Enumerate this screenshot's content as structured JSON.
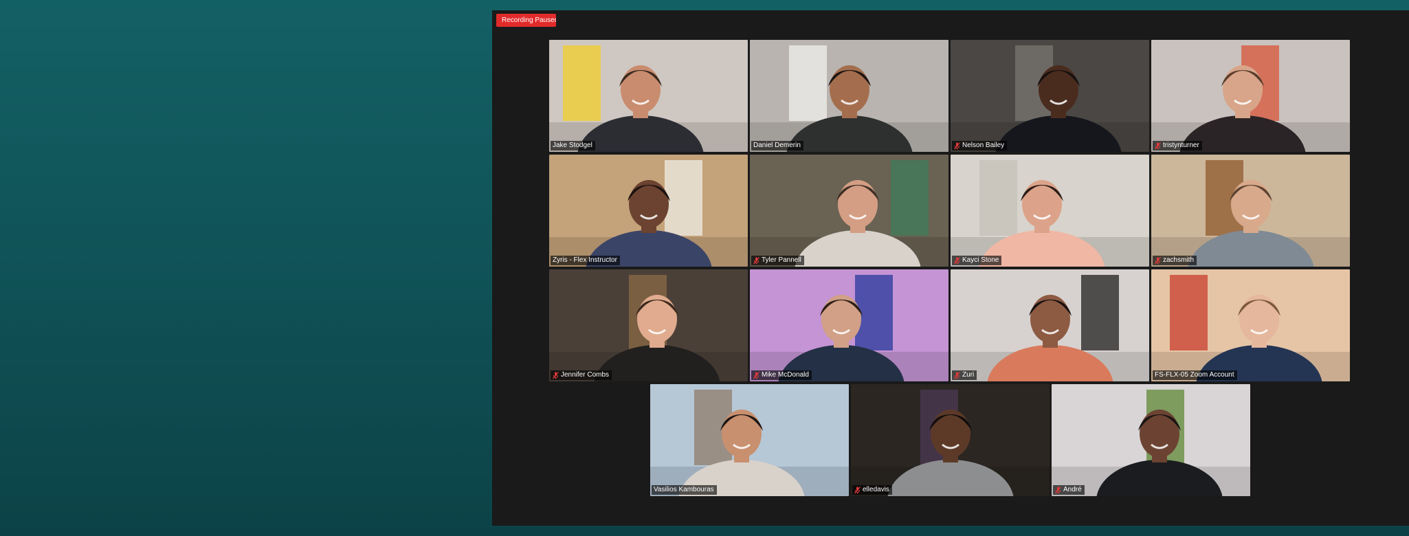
{
  "window": {
    "recording_status": "Recording Paused"
  },
  "participants": [
    {
      "name": "Jake Stodgel",
      "muted": false,
      "active": false,
      "wall": "#cfc7c1",
      "shirt": "#2c2d33",
      "skin": "#c98c6e",
      "hair": "#3a2a20",
      "accent": "#f2cf2a"
    },
    {
      "name": "Daniel Demerin",
      "muted": false,
      "active": true,
      "wall": "#b9b4b0",
      "shirt": "#2e302f",
      "skin": "#a46e4e",
      "hair": "#1c1412",
      "accent": "#f2f0ec"
    },
    {
      "name": "Nelson Bailey",
      "muted": true,
      "active": false,
      "wall": "#4a4744",
      "shirt": "#15171d",
      "skin": "#4a2c1f",
      "hair": "#161010",
      "accent": "#7a7570"
    },
    {
      "name": "tristynturner",
      "muted": true,
      "active": false,
      "wall": "#c9c2be",
      "shirt": "#2a2426",
      "skin": "#d8a58a",
      "hair": "#5b3d2c",
      "accent": "#d8553a"
    },
    {
      "name": "Zyris - Flex Instructor",
      "muted": false,
      "active": false,
      "wall": "#c4a27a",
      "shirt": "#3a4467",
      "skin": "#6b4330",
      "hair": "#1c1210",
      "accent": "#efece6"
    },
    {
      "name": "Tyler Pannell",
      "muted": true,
      "active": false,
      "wall": "#6a6253",
      "shirt": "#d8d2cb",
      "skin": "#d49e84",
      "hair": "#3f2f25",
      "accent": "#3f7c59"
    },
    {
      "name": "Kayci Stone",
      "muted": true,
      "active": false,
      "wall": "#d8d3cc",
      "shirt": "#efb7a4",
      "skin": "#dca38a",
      "hair": "#2b1d18",
      "accent": "#c6c1ba"
    },
    {
      "name": "zachsmith",
      "muted": true,
      "active": false,
      "wall": "#cdb79b",
      "shirt": "#7f8a94",
      "skin": "#d9a98c",
      "hair": "#5d4230",
      "accent": "#8f5a2c"
    },
    {
      "name": "Jennifer Combs",
      "muted": true,
      "active": false,
      "wall": "#4b4038",
      "shirt": "#22201f",
      "skin": "#e0ab8e",
      "hair": "#3e2a1f",
      "accent": "#8a6a46"
    },
    {
      "name": "Mike McDonald",
      "muted": true,
      "active": false,
      "wall": "#c494d4",
      "shirt": "#233045",
      "skin": "#d1a086",
      "hair": "#2d1e17",
      "accent": "#283a9c"
    },
    {
      "name": "Zuri",
      "muted": true,
      "active": false,
      "wall": "#d7d2cf",
      "shirt": "#d97a5c",
      "skin": "#8d5a42",
      "hair": "#181212",
      "accent": "#202020"
    },
    {
      "name": "FS-FLX-05 Zoom Account",
      "muted": false,
      "active": false,
      "wall": "#e6c5a6",
      "shirt": "#243554",
      "skin": "#e5b79c",
      "hair": "#7a5a3a",
      "accent": "#c83d2d"
    },
    {
      "name": "Vasilios Kambouras",
      "muted": false,
      "active": false,
      "wall": "#b6c7d6",
      "shirt": "#d9d2cb",
      "skin": "#c8906f",
      "hair": "#201714",
      "accent": "#8f7c69"
    },
    {
      "name": "elledavis",
      "muted": true,
      "active": false,
      "wall": "#2b2622",
      "shirt": "#8d8e8f",
      "skin": "#5d3a28",
      "hair": "#120e0d",
      "accent": "#4d3a55"
    },
    {
      "name": "André",
      "muted": true,
      "active": false,
      "wall": "#d9d4d5",
      "shirt": "#1b1c20",
      "skin": "#6c4332",
      "hair": "#1a1413",
      "accent": "#5e8a36"
    }
  ]
}
